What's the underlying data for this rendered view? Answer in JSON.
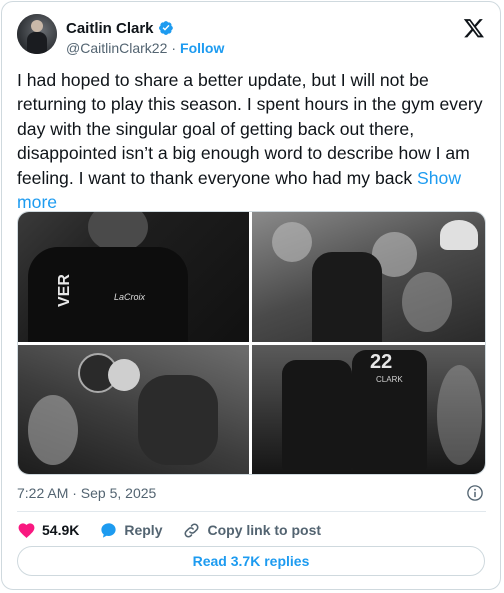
{
  "author": {
    "name": "Caitlin Clark",
    "handle": "@CaitlinClark22",
    "separator": "·",
    "follow_label": "Follow"
  },
  "tweet": {
    "text": "I had hoped to share a better update, but I will not be returning to play this season. I spent hours in the gym every day with the singular goal of getting back out there, disappointed isn’t a big enough word to describe how I am feeling. I want to thank everyone who had my back",
    "show_more_label": "Show more",
    "timestamp": "7:22 AM · Sep 5, 2025"
  },
  "media": {
    "photo_1": {
      "jersey_text": "VER",
      "logo_text": "LaCroix"
    },
    "photo_4": {
      "jersey_number": "22",
      "jersey_name": "CLARK"
    }
  },
  "actions": {
    "likes": "54.9K",
    "reply_label": "Reply",
    "copy_link_label": "Copy link to post"
  },
  "read_replies_label": "Read 3.7K replies",
  "icons": {
    "verified": "verified-badge-icon",
    "x_logo": "x-logo-icon",
    "info": "info-icon",
    "heart": "heart-icon",
    "reply": "reply-bubble-icon",
    "link": "link-icon"
  },
  "colors": {
    "accent": "#1d9bf0",
    "like": "#f91880",
    "text": "#0f1419",
    "muted": "#536471",
    "border": "#cfd9de"
  }
}
